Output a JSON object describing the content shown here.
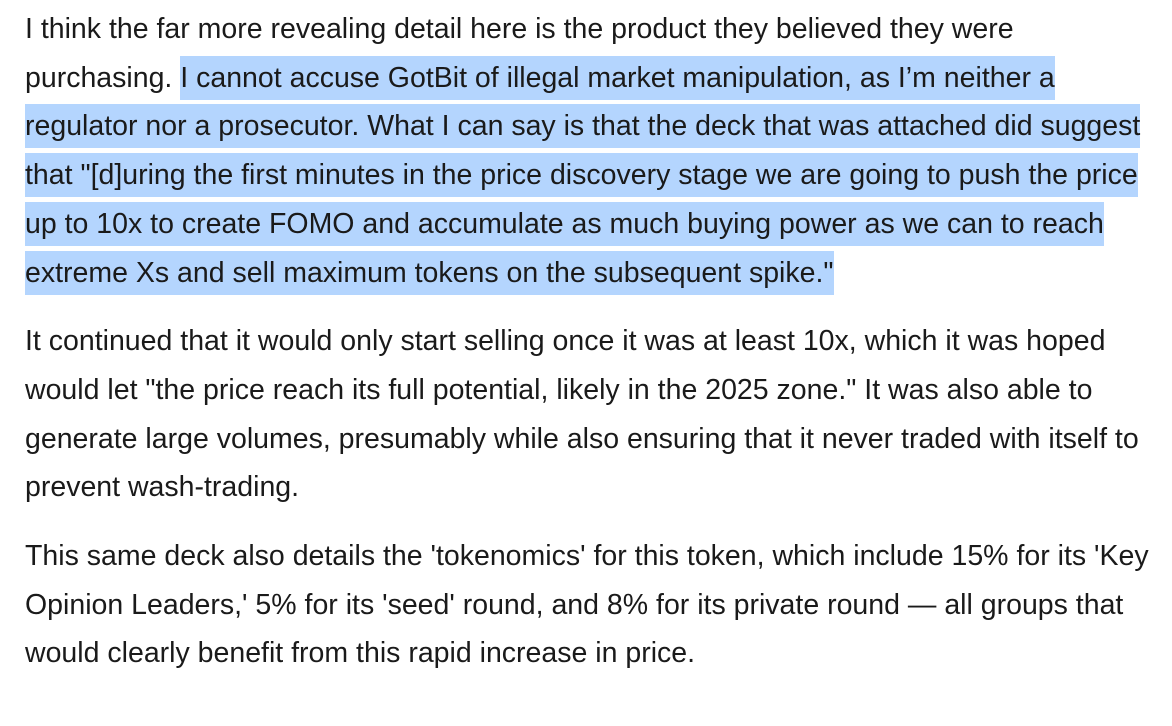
{
  "paragraphs": [
    {
      "plain": "I think the far more revealing detail here is the product they believed they were purchasing. ",
      "highlighted": "I cannot accuse GotBit of illegal market manipulation, as I’m neither a regulator nor a prosecutor. What I can say is that the deck that was attached did suggest that \"[d]uring the first minutes in the price discovery stage we are going to push the price up to 10x to create FOMO and accumulate as much buying power as we can to reach extreme Xs and sell maximum tokens on the subsequent spike.\""
    },
    {
      "text": "It continued that it would only start selling once it was at least 10x, which it was hoped would let \"the price reach its full potential, likely in the 2025 zone.\" It was also able to generate large volumes, presumably while also ensuring that it never traded with itself to prevent wash-trading."
    },
    {
      "text": "This same deck also details the 'tokenomics' for this token, which include 15% for its 'Key Opinion Leaders,' 5% for its 'seed' round, and 8% for its private round — all groups that would clearly benefit from this rapid increase in price."
    }
  ],
  "colors": {
    "text": "#1a1a1a",
    "selection_highlight": "#b4d5fe",
    "background": "#ffffff"
  }
}
